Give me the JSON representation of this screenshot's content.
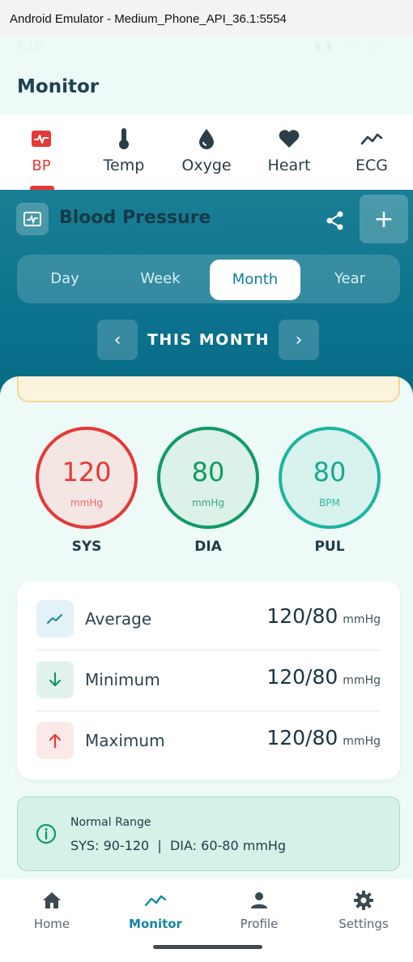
{
  "window": {
    "title": "Android Emulator - Medium_Phone_API_36.1:5554"
  },
  "statusbar": {
    "time": "9:10"
  },
  "appbar": {
    "title": "Monitor"
  },
  "tabs": [
    {
      "label": "BP",
      "icon": "bp-icon",
      "active": true
    },
    {
      "label": "Temp",
      "icon": "thermometer-icon",
      "active": false
    },
    {
      "label": "Oxyge",
      "icon": "droplet-icon",
      "active": false
    },
    {
      "label": "Heart",
      "icon": "heart-icon",
      "active": false
    },
    {
      "label": "ECG",
      "icon": "ecg-icon",
      "active": false
    }
  ],
  "header": {
    "title": "Blood Pressure",
    "share_icon": "share-icon",
    "add_label": "+"
  },
  "periods": [
    {
      "label": "Day",
      "active": false
    },
    {
      "label": "Week",
      "active": false
    },
    {
      "label": "Month",
      "active": true
    },
    {
      "label": "Year",
      "active": false
    }
  ],
  "navigator": {
    "label": "THIS MONTH",
    "prev": "‹",
    "next": "›"
  },
  "gauges": [
    {
      "value": "120",
      "unit": "mmHg",
      "label": "SYS",
      "color": "#e53935"
    },
    {
      "value": "80",
      "unit": "mmHg",
      "label": "DIA",
      "color": "#109a66"
    },
    {
      "value": "80",
      "unit": "BPM",
      "label": "PUL",
      "color": "#1bb59d"
    }
  ],
  "stats": [
    {
      "label": "Average",
      "value": "120/80",
      "unit": "mmHg",
      "icon": "trending-up-icon"
    },
    {
      "label": "Minimum",
      "value": "120/80",
      "unit": "mmHg",
      "icon": "arrow-down-icon"
    },
    {
      "label": "Maximum",
      "value": "120/80",
      "unit": "mmHg",
      "icon": "arrow-up-icon"
    }
  ],
  "normal_range": {
    "title": "Normal Range",
    "text": "SYS: 90-120  |  DIA: 60-80 mmHg"
  },
  "bottom_nav": [
    {
      "label": "Home",
      "icon": "home-icon",
      "active": false
    },
    {
      "label": "Monitor",
      "icon": "trending-up-icon",
      "active": true
    },
    {
      "label": "Profile",
      "icon": "person-icon",
      "active": false
    },
    {
      "label": "Settings",
      "icon": "gear-icon",
      "active": false
    }
  ],
  "colors": {
    "accent": "#1587a3",
    "alert": "#e53935",
    "success": "#109a66"
  }
}
